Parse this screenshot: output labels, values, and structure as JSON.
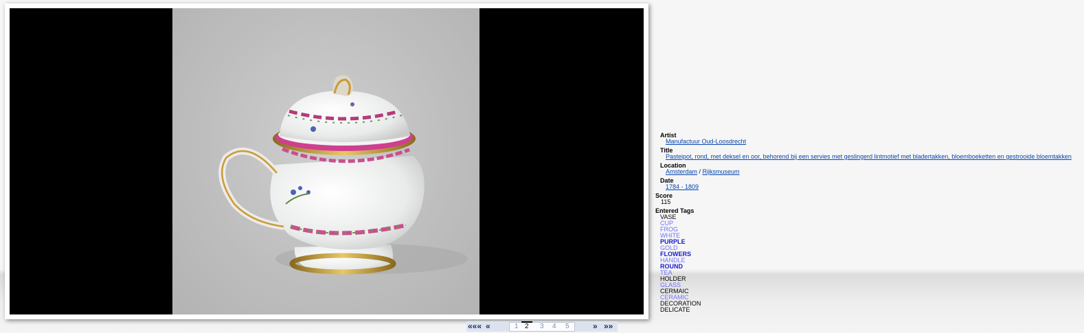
{
  "viewer": {
    "image_label": "Covered porcelain pot with handle"
  },
  "pager": {
    "first": "«««",
    "prev": "«",
    "pages": [
      "1",
      "2",
      "3",
      "4",
      "5"
    ],
    "current_page": "2",
    "next": "»",
    "last": "»»"
  },
  "info": {
    "artist_label": "Artist",
    "artist": "Manufactuur Oud-Loosdrecht",
    "title_label": "Title",
    "title": "Pasteipot, rond, met deksel en oor, behorend bij een servies met geslingerd lintmotief met bladertakken, bloemboeketten en gestrooide bloemtakken",
    "location_label": "Location",
    "location_city": "Amsterdam",
    "location_sep": " / ",
    "location_museum": "Rijksmuseum",
    "date_label": "Date",
    "date": "1784 - 1809",
    "score_label": "Score",
    "score": "115",
    "tags_label": "Entered Tags",
    "tags": [
      {
        "text": "VASE",
        "style": "plain"
      },
      {
        "text": "CUP",
        "style": "light"
      },
      {
        "text": "FROG",
        "style": "light"
      },
      {
        "text": "WHITE",
        "style": "light"
      },
      {
        "text": "PURPLE",
        "style": "bold"
      },
      {
        "text": "GOLD",
        "style": "light"
      },
      {
        "text": "FLOWERS",
        "style": "bold"
      },
      {
        "text": "HANDLE",
        "style": "light"
      },
      {
        "text": "ROUND",
        "style": "bold"
      },
      {
        "text": "TEA",
        "style": "light"
      },
      {
        "text": "HOLDER",
        "style": "plain"
      },
      {
        "text": "GLASS",
        "style": "light"
      },
      {
        "text": "CERMAIC",
        "style": "plain"
      },
      {
        "text": "CERAMIC",
        "style": "light"
      },
      {
        "text": "DECORATION",
        "style": "plain"
      },
      {
        "text": "DELICATE",
        "style": "plain"
      }
    ]
  }
}
